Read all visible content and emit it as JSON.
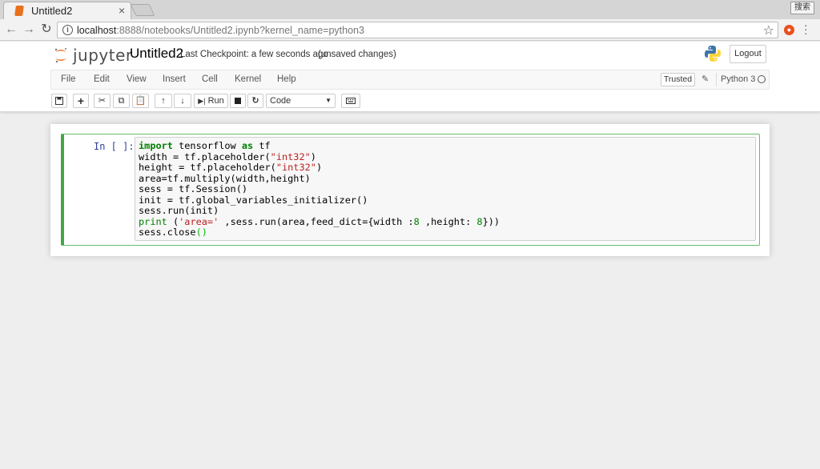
{
  "browser": {
    "tab_title": "Untitled2",
    "tab_close": "×",
    "url_host": "localhost",
    "url_rest": ":8888/notebooks/Untitled2.ipynb?kernel_name=python3",
    "os_badge": "搜索"
  },
  "header": {
    "logo_text": "jupyter",
    "notebook_name": "Untitled2",
    "checkpoint": "Last Checkpoint: a few seconds ago",
    "unsaved": "(unsaved changes)",
    "logout_label": "Logout"
  },
  "menubar": {
    "items": [
      "File",
      "Edit",
      "View",
      "Insert",
      "Cell",
      "Kernel",
      "Help"
    ],
    "trusted_label": "Trusted",
    "kernel_name": "Python 3"
  },
  "toolbar": {
    "run_label": "Run",
    "cell_type": "Code"
  },
  "cell": {
    "prompt": "In [ ]:",
    "lines": [
      "import tensorflow as tf",
      "width = tf.placeholder(\"int32\")",
      "height = tf.placeholder(\"int32\")",
      "area=tf.multiply(width,height)",
      "sess = tf.Session()",
      "init = tf.global_variables_initializer()",
      "sess.run(init)",
      "print ('area=' ,sess.run(area,feed_dict={width :8 ,height: 8}))",
      "sess.close()"
    ]
  }
}
